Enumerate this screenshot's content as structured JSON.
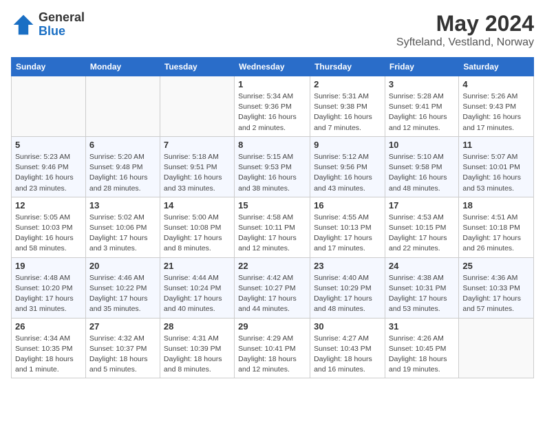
{
  "header": {
    "logo_general": "General",
    "logo_blue": "Blue",
    "month_year": "May 2024",
    "location": "Syfteland, Vestland, Norway"
  },
  "weekdays": [
    "Sunday",
    "Monday",
    "Tuesday",
    "Wednesday",
    "Thursday",
    "Friday",
    "Saturday"
  ],
  "weeks": [
    [
      {
        "day": "",
        "info": ""
      },
      {
        "day": "",
        "info": ""
      },
      {
        "day": "",
        "info": ""
      },
      {
        "day": "1",
        "info": "Sunrise: 5:34 AM\nSunset: 9:36 PM\nDaylight: 16 hours\nand 2 minutes."
      },
      {
        "day": "2",
        "info": "Sunrise: 5:31 AM\nSunset: 9:38 PM\nDaylight: 16 hours\nand 7 minutes."
      },
      {
        "day": "3",
        "info": "Sunrise: 5:28 AM\nSunset: 9:41 PM\nDaylight: 16 hours\nand 12 minutes."
      },
      {
        "day": "4",
        "info": "Sunrise: 5:26 AM\nSunset: 9:43 PM\nDaylight: 16 hours\nand 17 minutes."
      }
    ],
    [
      {
        "day": "5",
        "info": "Sunrise: 5:23 AM\nSunset: 9:46 PM\nDaylight: 16 hours\nand 23 minutes."
      },
      {
        "day": "6",
        "info": "Sunrise: 5:20 AM\nSunset: 9:48 PM\nDaylight: 16 hours\nand 28 minutes."
      },
      {
        "day": "7",
        "info": "Sunrise: 5:18 AM\nSunset: 9:51 PM\nDaylight: 16 hours\nand 33 minutes."
      },
      {
        "day": "8",
        "info": "Sunrise: 5:15 AM\nSunset: 9:53 PM\nDaylight: 16 hours\nand 38 minutes."
      },
      {
        "day": "9",
        "info": "Sunrise: 5:12 AM\nSunset: 9:56 PM\nDaylight: 16 hours\nand 43 minutes."
      },
      {
        "day": "10",
        "info": "Sunrise: 5:10 AM\nSunset: 9:58 PM\nDaylight: 16 hours\nand 48 minutes."
      },
      {
        "day": "11",
        "info": "Sunrise: 5:07 AM\nSunset: 10:01 PM\nDaylight: 16 hours\nand 53 minutes."
      }
    ],
    [
      {
        "day": "12",
        "info": "Sunrise: 5:05 AM\nSunset: 10:03 PM\nDaylight: 16 hours\nand 58 minutes."
      },
      {
        "day": "13",
        "info": "Sunrise: 5:02 AM\nSunset: 10:06 PM\nDaylight: 17 hours\nand 3 minutes."
      },
      {
        "day": "14",
        "info": "Sunrise: 5:00 AM\nSunset: 10:08 PM\nDaylight: 17 hours\nand 8 minutes."
      },
      {
        "day": "15",
        "info": "Sunrise: 4:58 AM\nSunset: 10:11 PM\nDaylight: 17 hours\nand 12 minutes."
      },
      {
        "day": "16",
        "info": "Sunrise: 4:55 AM\nSunset: 10:13 PM\nDaylight: 17 hours\nand 17 minutes."
      },
      {
        "day": "17",
        "info": "Sunrise: 4:53 AM\nSunset: 10:15 PM\nDaylight: 17 hours\nand 22 minutes."
      },
      {
        "day": "18",
        "info": "Sunrise: 4:51 AM\nSunset: 10:18 PM\nDaylight: 17 hours\nand 26 minutes."
      }
    ],
    [
      {
        "day": "19",
        "info": "Sunrise: 4:48 AM\nSunset: 10:20 PM\nDaylight: 17 hours\nand 31 minutes."
      },
      {
        "day": "20",
        "info": "Sunrise: 4:46 AM\nSunset: 10:22 PM\nDaylight: 17 hours\nand 35 minutes."
      },
      {
        "day": "21",
        "info": "Sunrise: 4:44 AM\nSunset: 10:24 PM\nDaylight: 17 hours\nand 40 minutes."
      },
      {
        "day": "22",
        "info": "Sunrise: 4:42 AM\nSunset: 10:27 PM\nDaylight: 17 hours\nand 44 minutes."
      },
      {
        "day": "23",
        "info": "Sunrise: 4:40 AM\nSunset: 10:29 PM\nDaylight: 17 hours\nand 48 minutes."
      },
      {
        "day": "24",
        "info": "Sunrise: 4:38 AM\nSunset: 10:31 PM\nDaylight: 17 hours\nand 53 minutes."
      },
      {
        "day": "25",
        "info": "Sunrise: 4:36 AM\nSunset: 10:33 PM\nDaylight: 17 hours\nand 57 minutes."
      }
    ],
    [
      {
        "day": "26",
        "info": "Sunrise: 4:34 AM\nSunset: 10:35 PM\nDaylight: 18 hours\nand 1 minute."
      },
      {
        "day": "27",
        "info": "Sunrise: 4:32 AM\nSunset: 10:37 PM\nDaylight: 18 hours\nand 5 minutes."
      },
      {
        "day": "28",
        "info": "Sunrise: 4:31 AM\nSunset: 10:39 PM\nDaylight: 18 hours\nand 8 minutes."
      },
      {
        "day": "29",
        "info": "Sunrise: 4:29 AM\nSunset: 10:41 PM\nDaylight: 18 hours\nand 12 minutes."
      },
      {
        "day": "30",
        "info": "Sunrise: 4:27 AM\nSunset: 10:43 PM\nDaylight: 18 hours\nand 16 minutes."
      },
      {
        "day": "31",
        "info": "Sunrise: 4:26 AM\nSunset: 10:45 PM\nDaylight: 18 hours\nand 19 minutes."
      },
      {
        "day": "",
        "info": ""
      }
    ]
  ]
}
